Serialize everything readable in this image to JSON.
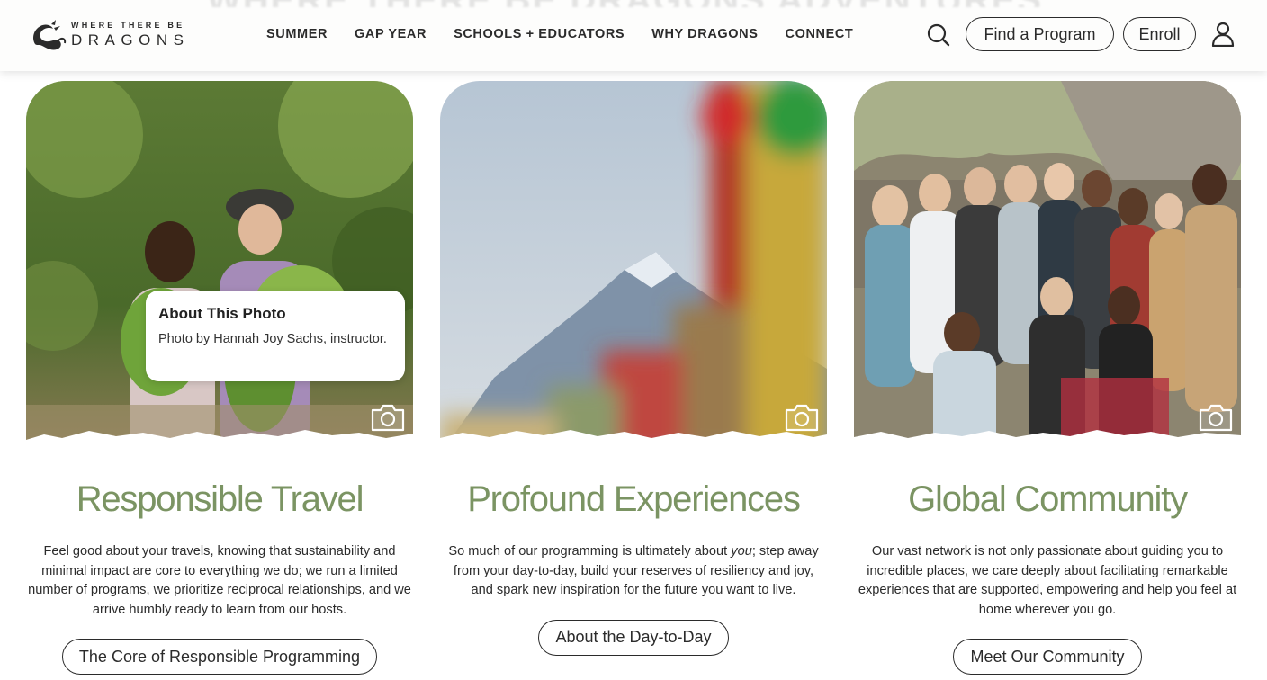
{
  "header": {
    "ghost_heading": "WHERE THERE BE DRAGONS ADVENTURES",
    "logo": {
      "top": "WHERE THERE BE",
      "bottom": "DRAGONS",
      "icon": "dragon-icon"
    },
    "nav": [
      "SUMMER",
      "GAP YEAR",
      "SCHOOLS + EDUCATORS",
      "WHY DRAGONS",
      "CONNECT"
    ],
    "search_icon": "search-icon",
    "find_program_label": "Find a Program",
    "enroll_label": "Enroll",
    "account_icon": "user-icon"
  },
  "cards": [
    {
      "title": "Responsible Travel",
      "text": "Feel good about your travels, knowing that sustainability and minimal impact are core to everything we do; we run a limited number of programs, we prioritize reciprocal relationships, and we arrive humbly ready to learn from our hosts.",
      "button": "The Core of Responsible Programming",
      "camera_icon": "camera-icon",
      "popover": {
        "title": "About This Photo",
        "text": "Photo by Hannah Joy Sachs, instructor."
      }
    },
    {
      "title": "Profound Experiences",
      "text_before": "So much of our programming is ultimately about ",
      "text_em": "you",
      "text_after": "; step away from your day-to-day, build your reserves of resiliency and joy, and spark new inspiration for the future you want to live.",
      "button": "About the Day-to-Day",
      "camera_icon": "camera-icon"
    },
    {
      "title": "Global Community",
      "text": "Our vast network is not only passionate about guiding you to incredible places, we care deeply about facilitating remarkable experiences that are supported, empowering and help you feel at home wherever you go.",
      "button": "Meet Our Community",
      "camera_icon": "camera-icon"
    }
  ],
  "colors": {
    "accent_green": "#7b9463",
    "text": "#2b2b2b",
    "header_bg": "#fdfdfc"
  }
}
